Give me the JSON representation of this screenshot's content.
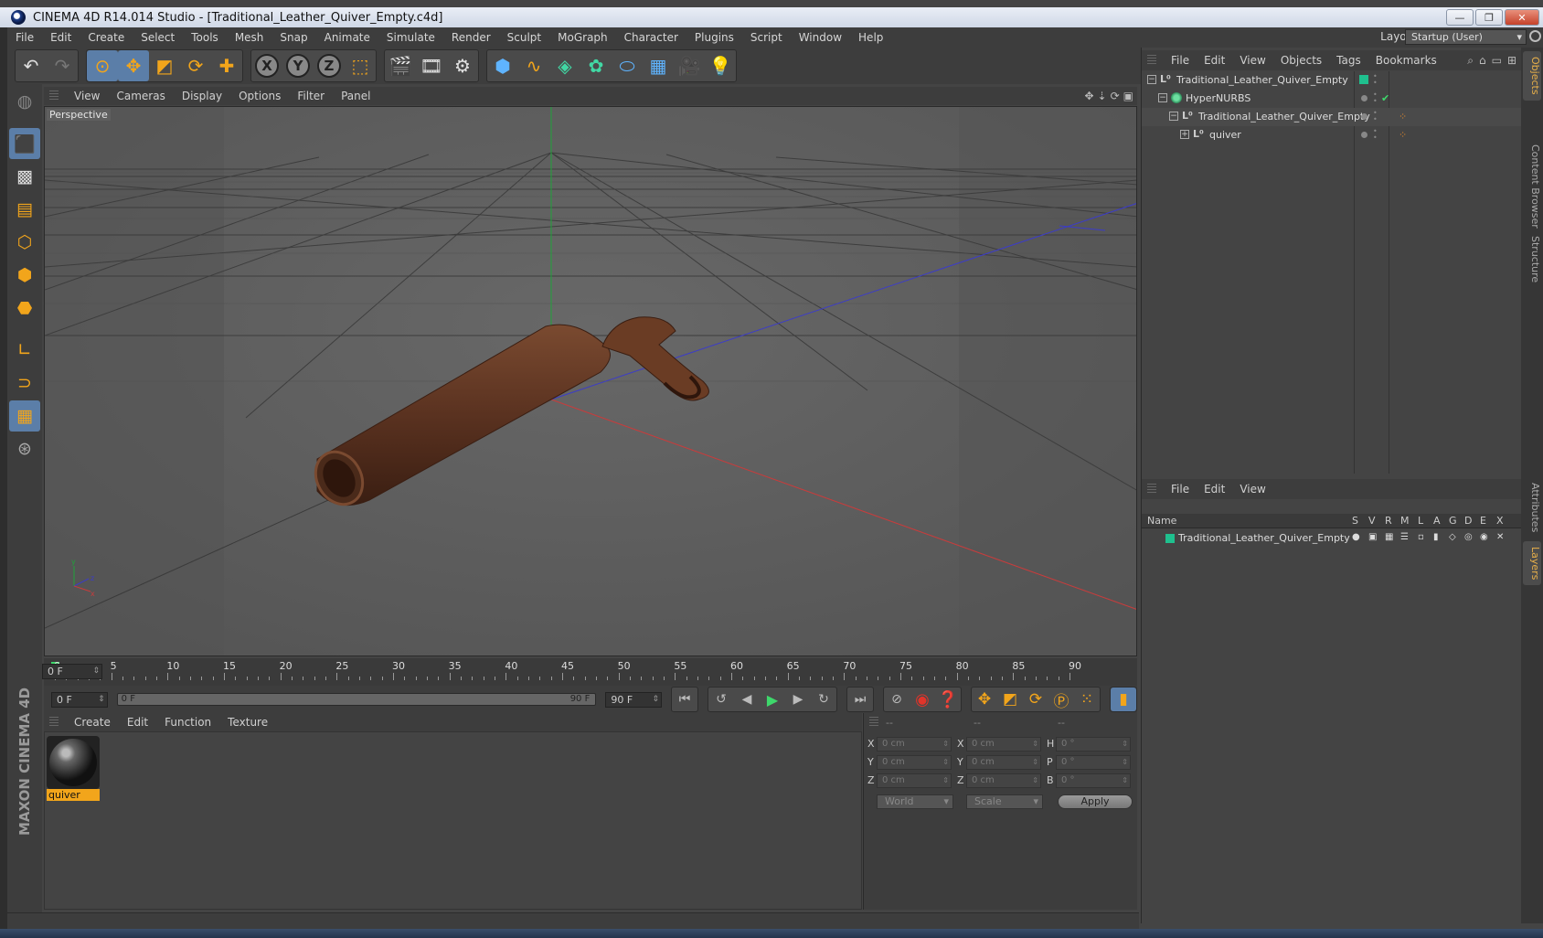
{
  "window": {
    "title": "CINEMA 4D R14.014 Studio - [Traditional_Leather_Quiver_Empty.c4d]"
  },
  "menubar": {
    "items": [
      "File",
      "Edit",
      "Create",
      "Select",
      "Tools",
      "Mesh",
      "Snap",
      "Animate",
      "Simulate",
      "Render",
      "Sculpt",
      "MoGraph",
      "Character",
      "Plugins",
      "Script",
      "Window",
      "Help"
    ],
    "layout_label": "Layout:",
    "layout_value": "Startup (User)"
  },
  "viewport": {
    "menu": [
      "View",
      "Cameras",
      "Display",
      "Options",
      "Filter",
      "Panel"
    ],
    "label": "Perspective"
  },
  "timeline": {
    "labels": [
      "0",
      "5",
      "10",
      "15",
      "20",
      "25",
      "30",
      "35",
      "40",
      "45",
      "50",
      "55",
      "60",
      "65",
      "70",
      "75",
      "80",
      "85",
      "90"
    ],
    "current_frame": "0 F"
  },
  "transport": {
    "start_field": "0 F",
    "range_start": "0 F",
    "range_end": "90 F",
    "end_field": "90 F"
  },
  "material_manager": {
    "menu": [
      "Create",
      "Edit",
      "Function",
      "Texture"
    ],
    "materials": [
      {
        "name": "quiver"
      }
    ]
  },
  "coordinates": {
    "head": [
      "--",
      "--",
      "--"
    ],
    "rows": [
      {
        "l1": "X",
        "v1": "0 cm",
        "l2": "X",
        "v2": "0 cm",
        "l3": "H",
        "v3": "0 °"
      },
      {
        "l1": "Y",
        "v1": "0 cm",
        "l2": "Y",
        "v2": "0 cm",
        "l3": "P",
        "v3": "0 °"
      },
      {
        "l1": "Z",
        "v1": "0 cm",
        "l2": "Z",
        "v2": "0 cm",
        "l3": "B",
        "v3": "0 °"
      }
    ],
    "mode_select": "World",
    "scale_select": "Scale",
    "apply_label": "Apply"
  },
  "object_manager": {
    "menu": [
      "File",
      "Edit",
      "View",
      "Objects",
      "Tags",
      "Bookmarks"
    ],
    "objects": [
      {
        "name": "Traditional_Leather_Quiver_Empty"
      },
      {
        "name": "HyperNURBS"
      },
      {
        "name": "Traditional_Leather_Quiver_Empty"
      },
      {
        "name": "quiver"
      }
    ]
  },
  "layer_manager": {
    "menu": [
      "File",
      "Edit",
      "View"
    ],
    "columns": [
      "Name",
      "S",
      "V",
      "R",
      "M",
      "L",
      "A",
      "G",
      "D",
      "E",
      "X"
    ],
    "layers": [
      {
        "name": "Traditional_Leather_Quiver_Empty"
      }
    ]
  },
  "side_tabs": [
    "Objects",
    "Content Browser",
    "Structure",
    "Attributes",
    "Layers"
  ],
  "logo": {
    "text": "MAXON CINEMA 4D"
  },
  "colors": {
    "accent": "#f2a51b",
    "selection": "#5b7ea8",
    "layer": "#1fc08e",
    "play": "#3ed86b"
  }
}
